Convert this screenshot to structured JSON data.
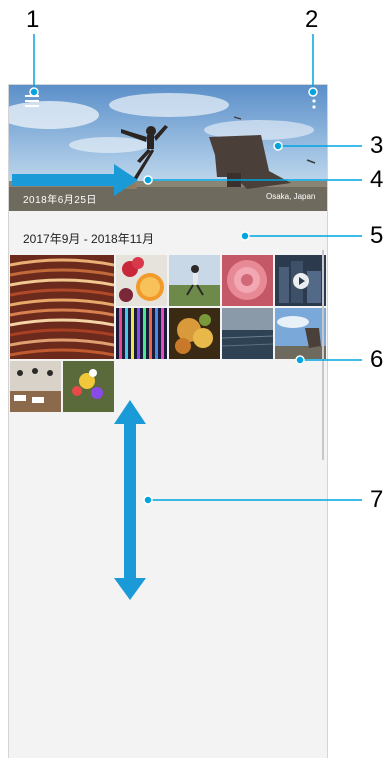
{
  "hero": {
    "date_text": "2018年6月25日",
    "place_text": "Osaka, Japan"
  },
  "section": {
    "range": "2017年9月 - 2018年11月"
  },
  "callouts": {
    "c1": "1",
    "c2": "2",
    "c3": "3",
    "c4": "4",
    "c5": "5",
    "c6": "6",
    "c7": "7"
  },
  "colors": {
    "callout_line": "#00a5e0",
    "arrow": "#1a9bd7"
  },
  "icons": {
    "menu": "menu-icon",
    "more": "more-vert-icon",
    "play": "play-icon"
  }
}
